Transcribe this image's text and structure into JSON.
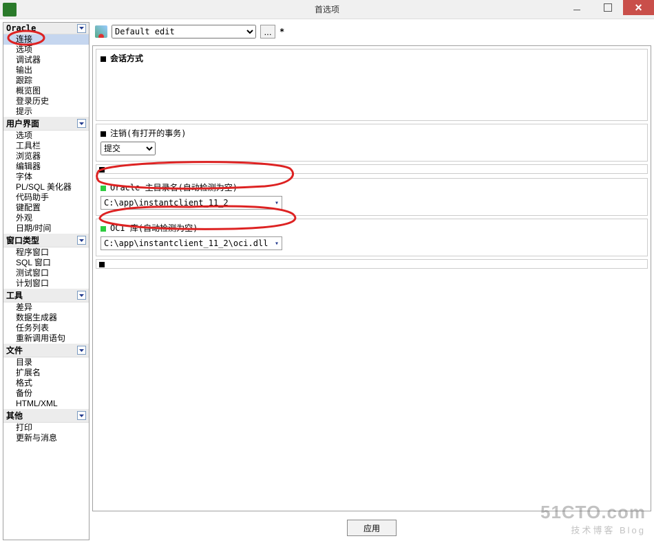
{
  "window": {
    "title": "首选项"
  },
  "toolbar": {
    "profile": "Default edit",
    "ellipsis": "...",
    "modified": "*"
  },
  "sidebar": {
    "groups": [
      {
        "label": "Oracle",
        "items": [
          "连接",
          "选项",
          "调试器",
          "输出",
          "跟踪",
          "概览图",
          "登录历史",
          "提示"
        ],
        "selectedIndex": 0
      },
      {
        "label": "用户界面",
        "items": [
          "选项",
          "工具栏",
          "浏览器",
          "编辑器",
          "字体",
          "PL/SQL 美化器",
          "代码助手",
          "键配置",
          "外观",
          "日期/时间"
        ]
      },
      {
        "label": "窗口类型",
        "items": [
          "程序窗口",
          "SQL 窗口",
          "测试窗口",
          "计划窗口"
        ]
      },
      {
        "label": "工具",
        "items": [
          "差异",
          "数据生成器",
          "任务列表",
          "重新调用语句"
        ]
      },
      {
        "label": "文件",
        "items": [
          "目录",
          "扩展名",
          "格式",
          "备份",
          "HTML/XML"
        ]
      },
      {
        "label": "其他",
        "items": [
          "打印",
          "更新与消息"
        ]
      }
    ]
  },
  "panels": {
    "session": {
      "title": "会话方式"
    },
    "logoff": {
      "title": "注销(有打开的事务)",
      "commit_value": "提交"
    },
    "home": {
      "title": "Oracle 主目录名(自动检测为空)",
      "value": "C:\\app\\instantclient_11_2"
    },
    "oci": {
      "title": "OCI 库(自动检测为空)",
      "value": "C:\\app\\instantclient_11_2\\oci.dll"
    }
  },
  "buttons": {
    "apply": "应用"
  },
  "watermark": {
    "line1": "51CTO.com",
    "line2": "技术博客   Blog"
  }
}
